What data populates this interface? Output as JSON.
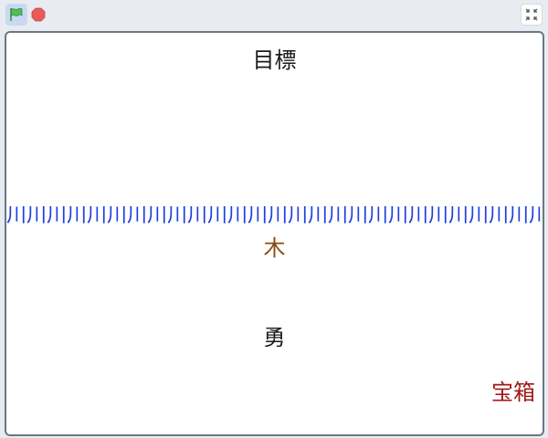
{
  "toolbar": {
    "green_flag_icon": "green-flag-icon",
    "stop_icon": "stop-icon",
    "fullscreen_icon": "exit-fullscreen-icon"
  },
  "stage": {
    "goal": "目標",
    "river": "川川川川川川川川川川川川川川川川川川川川川川川川川川川川川川川川川川川川川川川川川川川川川",
    "tree": "木",
    "hero": "勇",
    "treasure": "宝箱"
  },
  "colors": {
    "river": "#1f3fe0",
    "tree": "#8b4a13",
    "treasure": "#a01818",
    "flag": "#4cbf56",
    "stop": "#ec5959"
  }
}
